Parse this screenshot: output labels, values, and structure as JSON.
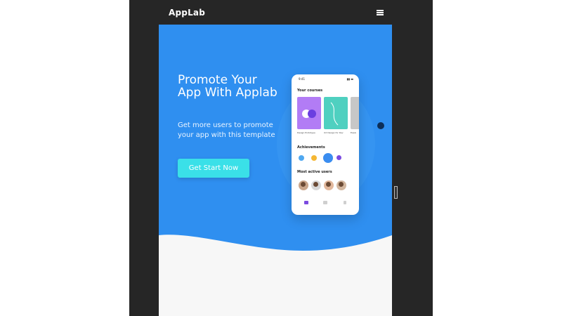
{
  "navbar": {
    "brand": "AppLab",
    "menu_icon": "hamburger-menu-icon"
  },
  "hero": {
    "title": "Promote Your App With Applab",
    "subtitle": "Get more users to promote your app with this template",
    "cta_label": "Get Start Now"
  },
  "phone_mockup": {
    "status_time": "9:41",
    "sections": {
      "courses_heading": "Your courses",
      "achievements_heading": "Achievements",
      "active_users_heading": "Most active users"
    },
    "courses": [
      {
        "label": "Design Prototype",
        "color": "#b27cf5"
      },
      {
        "label": "UX Design for Dev",
        "color": "#4fd0c0"
      },
      {
        "label": "Explo",
        "color": "#c7c7c7"
      }
    ]
  },
  "colors": {
    "hero_blue": "#2f8ff0",
    "cta": "#3ae0e8",
    "frame": "#262626"
  }
}
